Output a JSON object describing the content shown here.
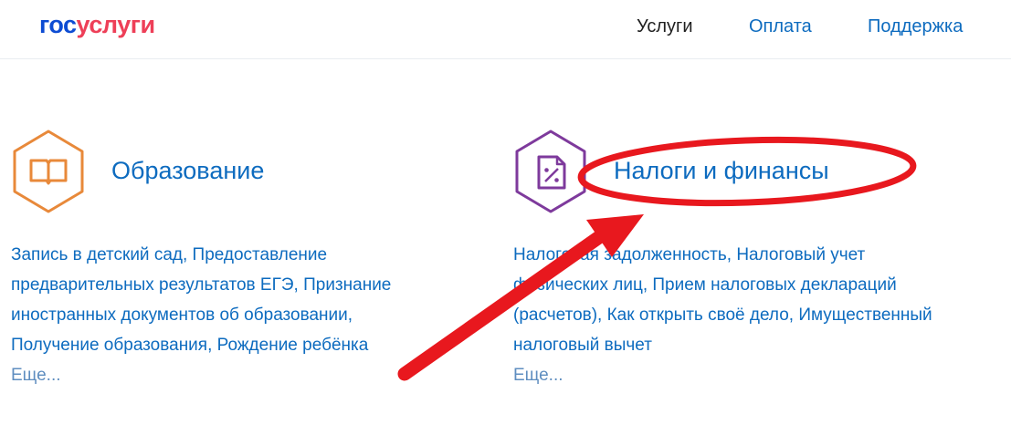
{
  "header": {
    "logo_part1": "гос",
    "logo_part2": "услуги",
    "nav": [
      {
        "label": "Услуги"
      },
      {
        "label": "Оплата"
      },
      {
        "label": "Поддержка"
      }
    ]
  },
  "cards": [
    {
      "icon": "open-book-icon",
      "title": "Образование",
      "description": "Запись в детский сад, Предоставление предварительных результатов ЕГЭ, Признание иностранных документов об образовании, Получение образования, Рождение ребёнка",
      "more": "Еще..."
    },
    {
      "icon": "tax-document-percent-icon",
      "title": "Налоги и финансы",
      "description": "Налоговая задолженность, Налоговый учет физических лиц, Прием налоговых деклараций (расчетов), Как открыть своё дело, Имущественный налоговый вычет",
      "more": "Еще..."
    }
  ],
  "colors": {
    "logo_blue": "#0d4cd3",
    "logo_red": "#ee3f58",
    "link_blue": "#0d6bbf",
    "education_orange": "#e8893a",
    "tax_purple": "#7e3a9c",
    "annotation_red": "#e8181e"
  }
}
